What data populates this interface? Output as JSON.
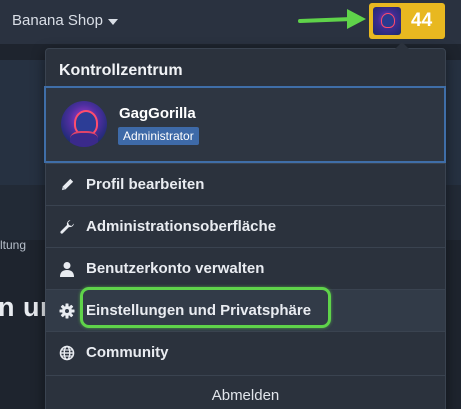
{
  "header": {
    "shop_label": "Banana Shop",
    "notification_count": "44"
  },
  "background": {
    "partial_label": "ltung",
    "partial_heading": "n ur"
  },
  "dropdown": {
    "title": "Kontrollzentrum",
    "profile": {
      "name": "GagGorilla",
      "role": "Administrator"
    },
    "items": [
      {
        "label": "Profil bearbeiten",
        "icon": "pencil-icon"
      },
      {
        "label": "Administrationsoberfläche",
        "icon": "wrench-icon"
      },
      {
        "label": "Benutzerkonto verwalten",
        "icon": "user-icon"
      },
      {
        "label": "Einstellungen und Privatsphäre",
        "icon": "gear-icon"
      },
      {
        "label": "Community",
        "icon": "globe-icon"
      }
    ],
    "logout_label": "Abmelden"
  },
  "colors": {
    "accent_badge": "#e8b820",
    "highlight_ring": "#5fd34a",
    "annotation_arrow": "#5fd34a",
    "role_badge": "#3e6aa8"
  }
}
